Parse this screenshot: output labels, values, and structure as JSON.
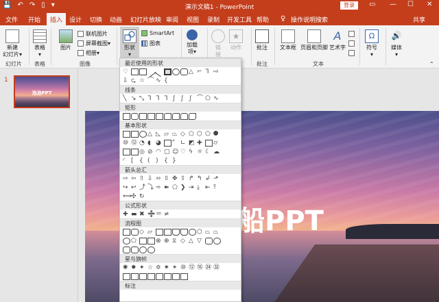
{
  "titlebar": {
    "title": "演示文稿1 - PowerPoint",
    "login": "登录",
    "quick_access": [
      "💾",
      "↶",
      "↷",
      "▯",
      "▾"
    ],
    "controls": [
      "▭",
      "—",
      "☐",
      "✕"
    ]
  },
  "tabs": [
    "文件",
    "开始",
    "插入",
    "设计",
    "切换",
    "动画",
    "幻灯片放映",
    "审阅",
    "视图",
    "录制",
    "开发工具",
    "帮助",
    "操作说明搜索",
    "共享"
  ],
  "ribbon": {
    "new_slide": [
      "新建",
      "幻灯片▾"
    ],
    "table": [
      "表格",
      "▾"
    ],
    "picture": "图片",
    "online_pictures": "联机图片",
    "screenshot": "屏幕截图▾",
    "album": "相册▾",
    "shapes": [
      "形状",
      "▾"
    ],
    "smartart": "SmartArt",
    "chart": "图表",
    "addins": [
      "加载",
      "项▾"
    ],
    "link": [
      "链",
      "接"
    ],
    "action": "动作",
    "comment": "批注",
    "textbox": "文本框",
    "header_footer": "页眉和页脚",
    "wordart": [
      "艺术字",
      "▾"
    ],
    "symbol": [
      "符号",
      "▾"
    ],
    "media": [
      "媒体",
      "▾"
    ],
    "groups": [
      "幻灯片",
      "表格",
      "图像",
      "批注",
      "文本"
    ]
  },
  "thumbnail": {
    "number": "1",
    "title": "泡池PPT"
  },
  "slide": {
    "title": "船PPT"
  },
  "shapes_gallery": {
    "sections": [
      "最近使用的形状",
      "线条",
      "矩形",
      "基本形状",
      "箭头总汇",
      "公式形状",
      "流程图",
      "星与旗帜",
      "标注"
    ]
  },
  "colors": {
    "accent": "#c43e1c"
  }
}
